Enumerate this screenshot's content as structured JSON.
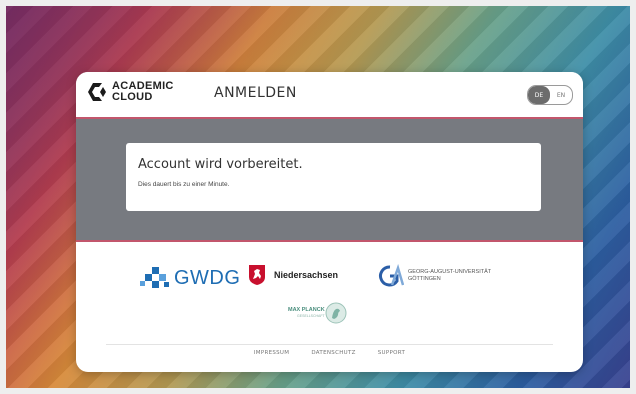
{
  "brand": {
    "logo_text_line1": "ACADEMIC",
    "logo_text_line2": "CLOUD",
    "logo_icon": "academic-cloud-logo-icon"
  },
  "header": {
    "title": "ANMELDEN"
  },
  "language": {
    "options": [
      "DE",
      "EN"
    ],
    "selected": "DE"
  },
  "status": {
    "title": "Account wird vorbereitet.",
    "subtitle": "Dies dauert bis zu einer Minute."
  },
  "partners": {
    "gwdg": "GWDG",
    "niedersachsen": "Niedersachsen",
    "goettingen_line1": "GEORG-AUGUST-UNIVERSITÄT",
    "goettingen_line2": "GÖTTINGEN",
    "mpg_line1": "MAX PLANCK",
    "mpg_line2": "GESELLSCHAFT"
  },
  "footer": {
    "links": [
      "IMPRESSUM",
      "DATENSCHUTZ",
      "SUPPORT"
    ]
  },
  "colors": {
    "accent": "#c2566c",
    "gray_band": "#777a80",
    "gwdg_blue": "#1e6db3",
    "niedersachsen_red": "#c8102e",
    "goettingen_blue": "#2b5ea7",
    "mpg_green": "#4a8e7d"
  }
}
